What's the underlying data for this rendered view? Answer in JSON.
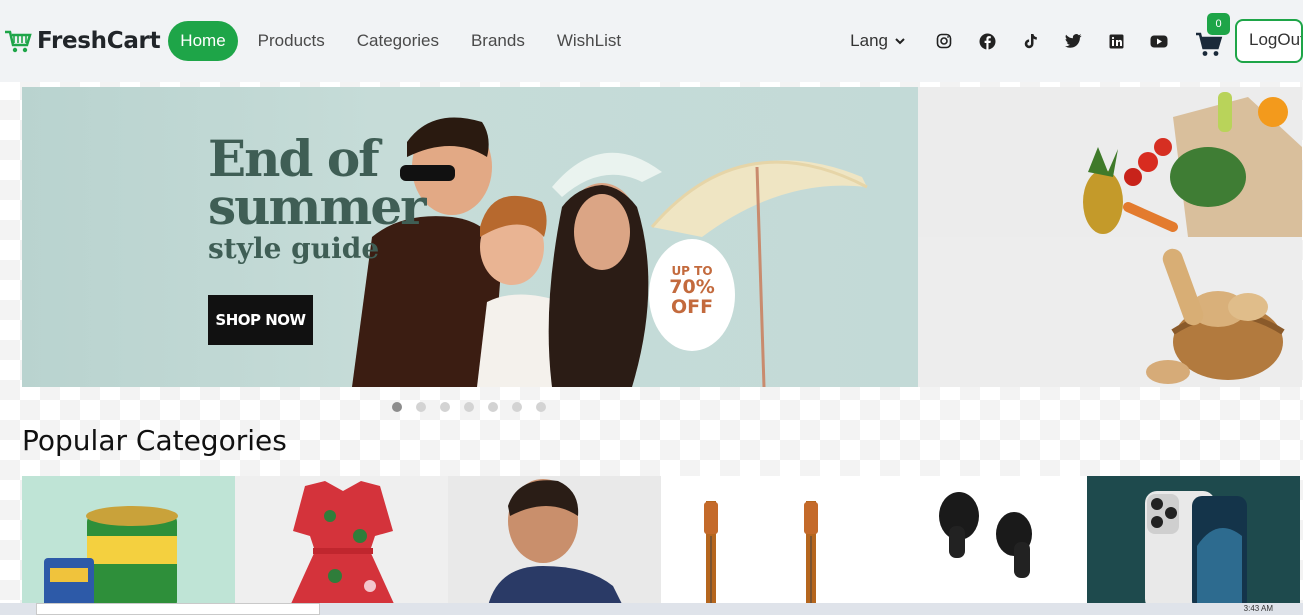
{
  "navbar": {
    "brand": "FreshCart",
    "brand_icon": "cart-icon",
    "items": [
      {
        "label": "Home",
        "active": true
      },
      {
        "label": "Products"
      },
      {
        "label": "Categories"
      },
      {
        "label": "Brands"
      },
      {
        "label": "WishList"
      }
    ],
    "lang_label": "Lang",
    "social_icons": [
      "instagram-icon",
      "facebook-icon",
      "tiktok-icon",
      "twitter-icon",
      "linkedin-icon",
      "youtube-icon"
    ],
    "cart_count": "0",
    "logout_label": "LogOut",
    "accent_color": "#1ea548"
  },
  "hero": {
    "headline_1": "End of",
    "headline_2": "summer",
    "headline_3": "style guide",
    "cta": "SHOP NOW",
    "offer_small": "UP TO",
    "offer_big_1": "70%",
    "offer_big_2": "OFF"
  },
  "slider_dots": 7,
  "section": {
    "title": "Popular Categories"
  },
  "categories": [
    "grocery",
    "dress",
    "menswear",
    "guitars",
    "earbuds",
    "phone"
  ],
  "taskbar": {
    "time": "3:43 AM"
  }
}
